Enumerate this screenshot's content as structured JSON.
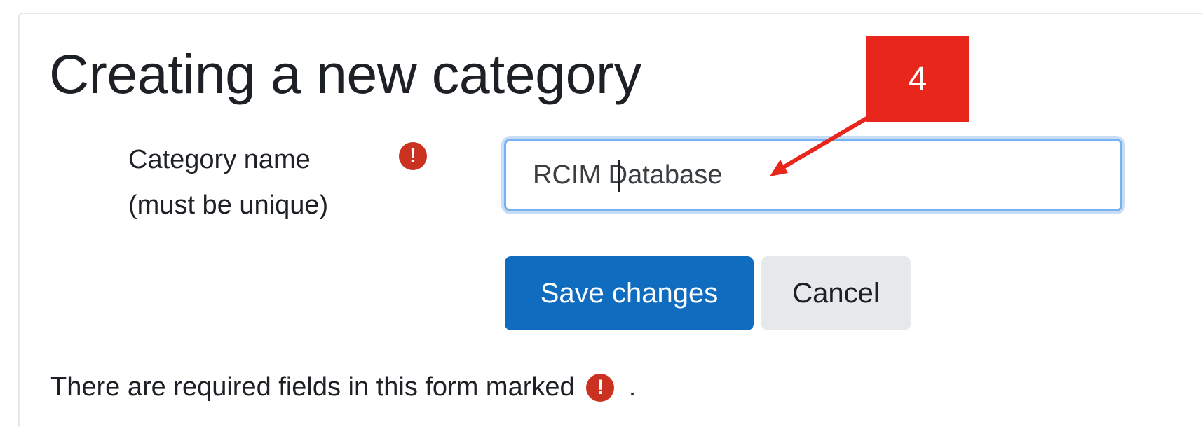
{
  "form": {
    "title": "Creating a new category",
    "field": {
      "label_line1": "Category name",
      "label_line2": "(must be unique)",
      "required_icon": "exclamation-circle-icon",
      "value": "RCIM Database"
    },
    "buttons": {
      "save_label": "Save changes",
      "cancel_label": "Cancel"
    },
    "required_note": {
      "text_before": "There are required fields in this form marked",
      "text_after": "."
    }
  },
  "annotation": {
    "step_number": "4",
    "color": "#e9261b"
  },
  "colors": {
    "primary": "#0f6cbf",
    "required": "#ca3120",
    "focus_border": "#74b2f1"
  }
}
